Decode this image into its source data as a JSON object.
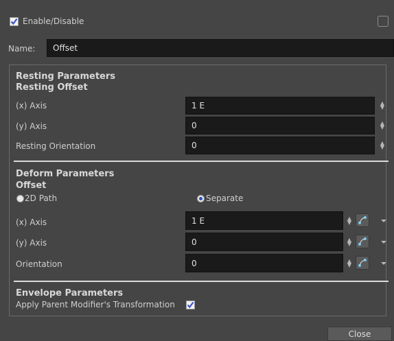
{
  "header": {
    "enable_label": "Enable/Disable",
    "enabled": true
  },
  "name_row": {
    "label": "Name:",
    "value": "Offset"
  },
  "resting": {
    "section_title": "Resting Parameters",
    "sub_title": "Resting Offset",
    "x_label": "(x) Axis",
    "x_value": "1 E",
    "y_label": "(y) Axis",
    "y_value": "0",
    "orient_label": "Resting Orientation",
    "orient_value": "0"
  },
  "deform": {
    "section_title": "Deform Parameters",
    "sub_title": "Offset",
    "radio_2d": "2D Path",
    "radio_separate": "Separate",
    "selected": "Separate",
    "x_label": "(x) Axis",
    "x_value": "1 E",
    "y_label": "(y) Axis",
    "y_value": "0",
    "orient_label": "Orientation",
    "orient_value": "0"
  },
  "envelope": {
    "section_title": "Envelope Parameters",
    "apply_label": "Apply Parent Modifier's Transformation",
    "apply_checked": true
  },
  "footer": {
    "close_label": "Close"
  },
  "icons": [
    "checkbox-icon",
    "spinner-icon",
    "function-curve-icon",
    "dropdown-arrow-icon",
    "radio-icon"
  ]
}
